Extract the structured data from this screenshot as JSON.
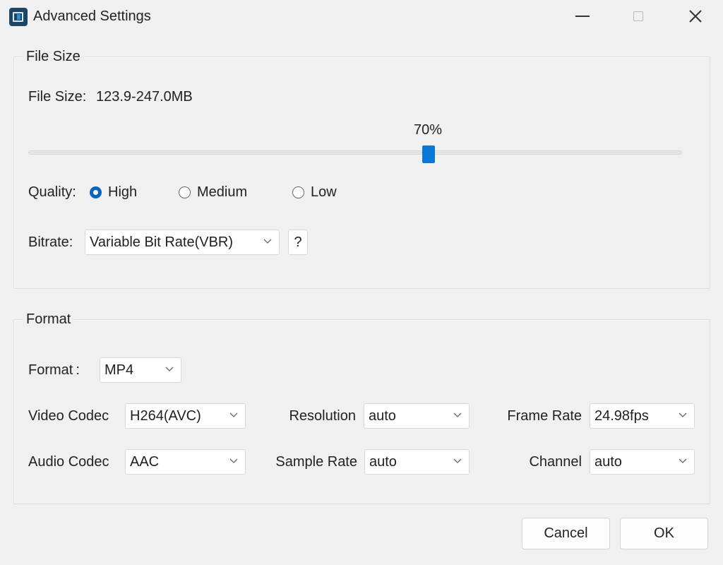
{
  "window": {
    "title": "Advanced Settings",
    "app_icon": "app-logo-icon",
    "controls": {
      "minimize": "minimize-icon",
      "maximize": "maximize-icon",
      "close": "close-icon"
    }
  },
  "file_size_group": {
    "legend": "File Size",
    "file_size_label": "File Size:",
    "file_size_value": "123.9-247.0MB",
    "slider": {
      "value_percent": 70,
      "value_label": "70%"
    },
    "quality": {
      "label": "Quality:",
      "options": [
        {
          "label": "High",
          "checked": true
        },
        {
          "label": "Medium",
          "checked": false
        },
        {
          "label": "Low",
          "checked": false
        }
      ]
    },
    "bitrate": {
      "label": "Bitrate:",
      "value": "Variable Bit Rate(VBR)",
      "help_label": "?"
    }
  },
  "format_group": {
    "legend": "Format",
    "format": {
      "label": "Format :",
      "value": "MP4"
    },
    "video_codec": {
      "label": "Video Codec",
      "value": "H264(AVC)"
    },
    "audio_codec": {
      "label": "Audio Codec",
      "value": "AAC"
    },
    "resolution": {
      "label": "Resolution",
      "value": "auto"
    },
    "sample_rate": {
      "label": "Sample Rate",
      "value": "auto"
    },
    "frame_rate": {
      "label": "Frame Rate",
      "value": "24.98fps"
    },
    "channel": {
      "label": "Channel",
      "value": "auto"
    }
  },
  "footer": {
    "cancel_label": "Cancel",
    "ok_label": "OK"
  },
  "colors": {
    "accent": "#0a78d7",
    "radio_checked": "#0a64c2",
    "background": "#f0f0f0"
  }
}
